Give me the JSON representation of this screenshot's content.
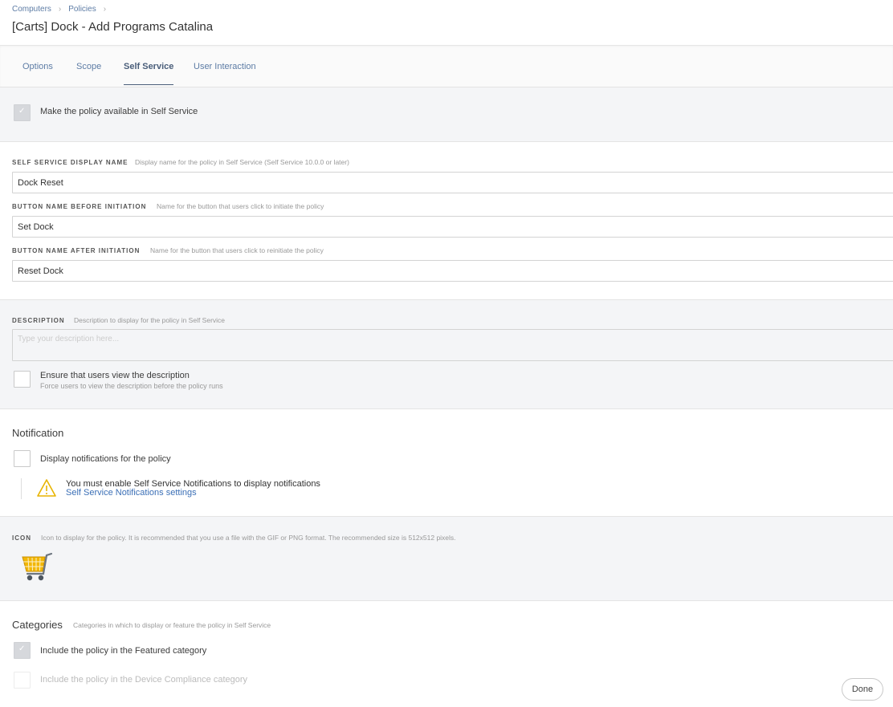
{
  "breadcrumb": [
    "Computers",
    "Policies"
  ],
  "page_title": "[Carts] Dock - Add Programs Catalina",
  "tabs": [
    {
      "label": "Options",
      "active": false
    },
    {
      "label": "Scope",
      "active": false
    },
    {
      "label": "Self Service",
      "active": true
    },
    {
      "label": "User Interaction",
      "active": false
    }
  ],
  "make_available": {
    "label": "Make the policy available in Self Service",
    "checked": true
  },
  "display_name": {
    "label": "SELF SERVICE DISPLAY NAME",
    "hint": "Display name for the policy in Self Service (Self Service 10.0.0 or later)",
    "value": "Dock Reset"
  },
  "button_before": {
    "label": "BUTTON NAME BEFORE INITIATION",
    "hint": "Name for the button that users click to initiate the policy",
    "value": "Set Dock"
  },
  "button_after": {
    "label": "BUTTON NAME AFTER INITIATION",
    "hint": "Name for the button that users click to reinitiate the policy",
    "value": "Reset Dock"
  },
  "description": {
    "label": "DESCRIPTION",
    "hint": "Description to display for the policy in Self Service",
    "placeholder": "Type your description here..."
  },
  "ensure_view": {
    "label": "Ensure that users view the description",
    "sub": "Force users to view the description before the policy runs",
    "checked": false
  },
  "notification": {
    "heading": "Notification",
    "checkbox_label": "Display notifications for the policy",
    "checked": false,
    "warning": "You must enable Self Service Notifications to display notifications",
    "link": "Self Service Notifications settings"
  },
  "icon": {
    "label": "ICON",
    "hint": "Icon to display for the policy. It is recommended that you use a file with the GIF or PNG format. The recommended size is 512x512 pixels.",
    "image": "shopping-cart-icon"
  },
  "categories": {
    "heading": "Categories",
    "hint": "Categories in which to display or feature the policy in Self Service",
    "featured": {
      "label": "Include the policy in the Featured category",
      "checked": true
    },
    "compliance": {
      "label": "Include the policy in the Device Compliance category",
      "checked": false
    }
  },
  "done_label": "Done",
  "colors": {
    "link": "#5d7ca5",
    "warning": "#e8b400",
    "cart": "#f2b705"
  }
}
